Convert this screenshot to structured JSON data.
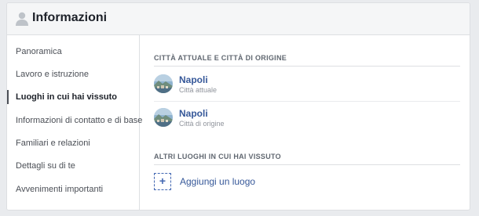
{
  "header": {
    "title": "Informazioni"
  },
  "sidebar": {
    "items": [
      {
        "label": "Panoramica",
        "active": false
      },
      {
        "label": "Lavoro e istruzione",
        "active": false
      },
      {
        "label": "Luoghi in cui hai vissuto",
        "active": true
      },
      {
        "label": "Informazioni di contatto e di base",
        "active": false
      },
      {
        "label": "Familiari e relazioni",
        "active": false
      },
      {
        "label": "Dettagli su di te",
        "active": false
      },
      {
        "label": "Avvenimenti importanti",
        "active": false
      }
    ]
  },
  "main": {
    "current_and_hometown": {
      "title": "CITTÀ ATTUALE E CITTÀ DI ORIGINE",
      "places": [
        {
          "name": "Napoli",
          "subtitle": "Città attuale"
        },
        {
          "name": "Napoli",
          "subtitle": "Città di origine"
        }
      ]
    },
    "other_places": {
      "title": "ALTRI LUOGHI IN CUI HAI VISSUTO",
      "add_icon": "+",
      "add_label": "Aggiungi un luogo"
    }
  },
  "colors": {
    "link": "#365899",
    "accent": "#4267b2",
    "text": "#1d2129",
    "muted": "#90949c"
  },
  "icons": {
    "header": "person-icon",
    "place_thumb": "city-photo-icon",
    "add": "plus-icon"
  }
}
